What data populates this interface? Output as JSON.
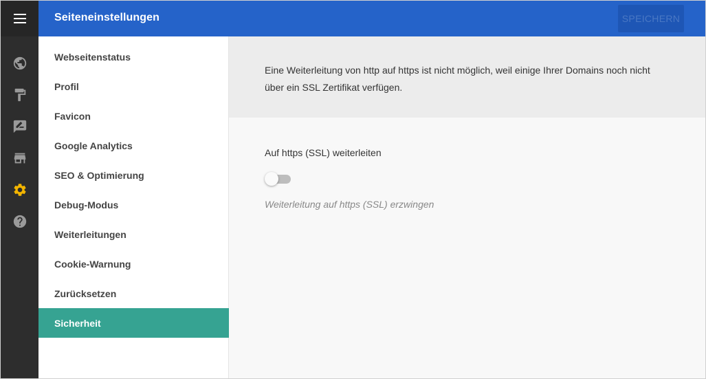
{
  "colors": {
    "rail_bg": "#2d2d2d",
    "header_bg": "#2563c9",
    "active_nav_bg": "#36a392",
    "active_rail_icon": "#f2b400",
    "rail_icon": "#9a9a9a"
  },
  "rail": {
    "menu_icon": "hamburger-menu-icon",
    "icons": [
      {
        "name": "globe-icon",
        "active": false
      },
      {
        "name": "paint-roller-icon",
        "active": false
      },
      {
        "name": "edit-comment-icon",
        "active": false
      },
      {
        "name": "store-icon",
        "active": false
      },
      {
        "name": "gear-icon",
        "active": true
      },
      {
        "name": "help-icon",
        "active": false
      }
    ]
  },
  "header": {
    "title": "Seiteneinstellungen",
    "save_label": "SPEICHERN"
  },
  "nav": {
    "items": [
      {
        "label": "Webseitenstatus",
        "active": false
      },
      {
        "label": "Profil",
        "active": false
      },
      {
        "label": "Favicon",
        "active": false
      },
      {
        "label": "Google Analytics",
        "active": false
      },
      {
        "label": "SEO & Optimierung",
        "active": false
      },
      {
        "label": "Debug-Modus",
        "active": false
      },
      {
        "label": "Weiterleitungen",
        "active": false
      },
      {
        "label": "Cookie-Warnung",
        "active": false
      },
      {
        "label": "Zurücksetzen",
        "active": false
      },
      {
        "label": "Sicherheit",
        "active": true
      }
    ]
  },
  "main": {
    "notice_line1": "Eine Weiterleitung von http auf https ist nicht möglich, weil einige Ihrer Domains noch nicht",
    "notice_line2": "über ein SSL Zertifikat verfügen.",
    "ssl_redirect": {
      "label": "Auf https (SSL) weiterleiten",
      "enabled": false,
      "help": "Weiterleitung auf https (SSL) erzwingen"
    }
  }
}
